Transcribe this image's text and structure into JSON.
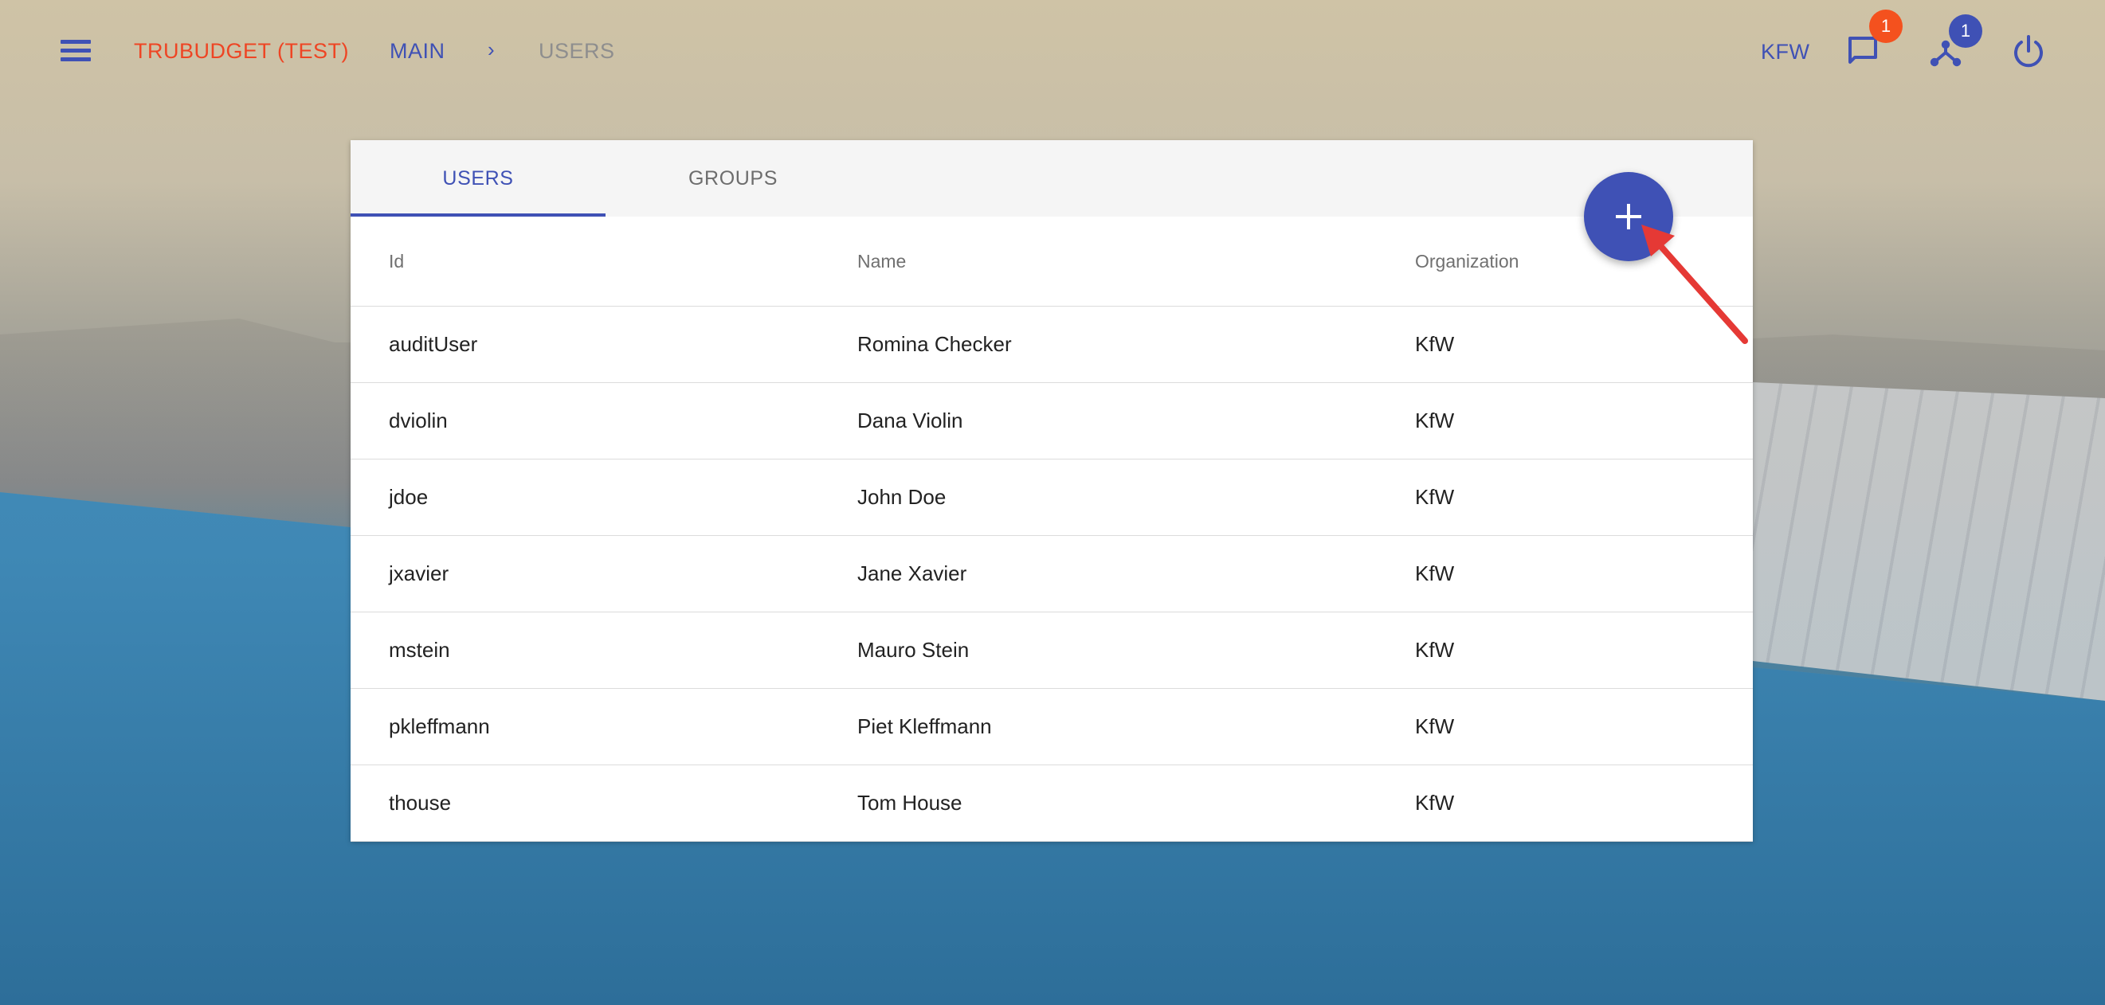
{
  "app": {
    "title": "TRUBUDGET (TEST)"
  },
  "breadcrumb": {
    "main": "MAIN",
    "separator": "›",
    "current": "USERS"
  },
  "header": {
    "organization": "KFW",
    "notifications_count": "1",
    "peers_count": "1"
  },
  "tabs": [
    {
      "label": "USERS",
      "selected": true
    },
    {
      "label": "GROUPS",
      "selected": false
    }
  ],
  "table": {
    "columns": [
      "Id",
      "Name",
      "Organization"
    ],
    "rows": [
      {
        "id": "auditUser",
        "name": "Romina Checker",
        "organization": "KfW"
      },
      {
        "id": "dviolin",
        "name": "Dana Violin",
        "organization": "KfW"
      },
      {
        "id": "jdoe",
        "name": "John Doe",
        "organization": "KfW"
      },
      {
        "id": "jxavier",
        "name": "Jane Xavier",
        "organization": "KfW"
      },
      {
        "id": "mstein",
        "name": "Mauro Stein",
        "organization": "KfW"
      },
      {
        "id": "pkleffmann",
        "name": "Piet Kleffmann",
        "organization": "KfW"
      },
      {
        "id": "thouse",
        "name": "Tom House",
        "organization": "KfW"
      }
    ]
  },
  "icons": {
    "menu": "menu-icon",
    "notifications": "chat-icon",
    "network": "share-network-icon",
    "logout": "power-icon",
    "add": "plus-icon",
    "annotation": "red-arrow"
  },
  "colors": {
    "primary": "#3f51b5",
    "accent": "#ee4524",
    "badge_red": "#f4511e",
    "annotation_arrow": "#e53935"
  }
}
